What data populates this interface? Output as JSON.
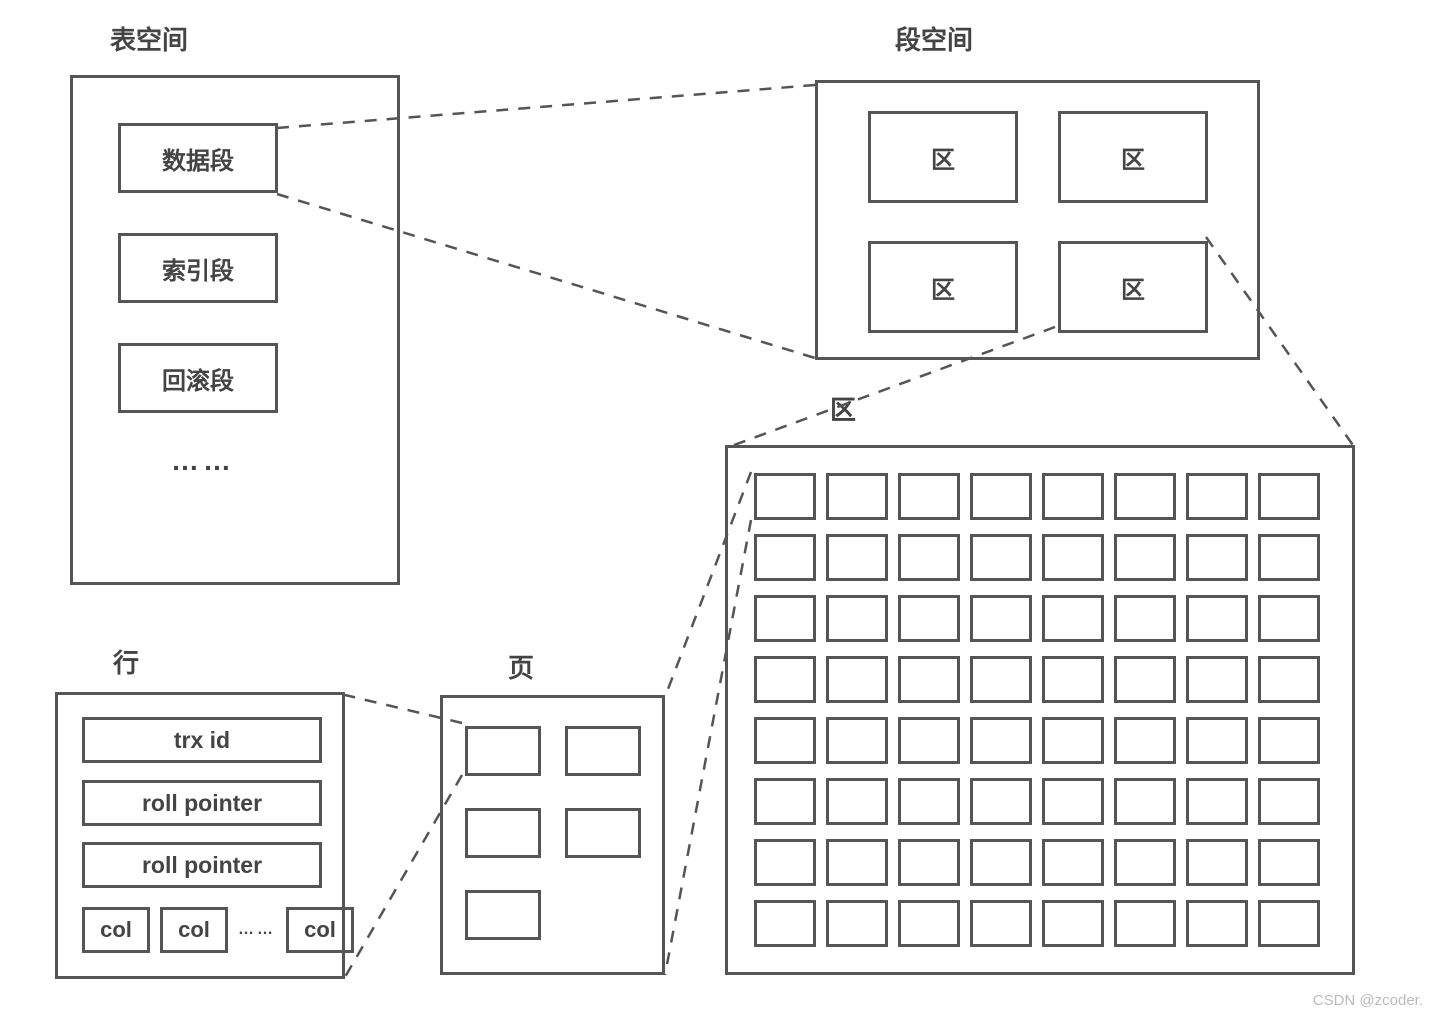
{
  "titles": {
    "tablespace": "表空间",
    "segmentspace": "段空间",
    "row": "行",
    "page": "页",
    "extent": "区"
  },
  "tablespace": {
    "segments": [
      "数据段",
      "索引段",
      "回滚段"
    ],
    "ellipsis": "……"
  },
  "segmentspace": {
    "cells": [
      "区",
      "区",
      "区",
      "区"
    ]
  },
  "extent": {
    "page_rows": 8,
    "page_cols": 8
  },
  "page": {
    "cell_rows": 3,
    "cell_cols": 2,
    "cells_shown": 5
  },
  "row": {
    "fields": [
      "trx id",
      "roll pointer",
      "roll pointer"
    ],
    "cols": [
      "col",
      "col",
      "col"
    ],
    "col_ellipsis": "……"
  },
  "watermark": "CSDN @zcoder."
}
